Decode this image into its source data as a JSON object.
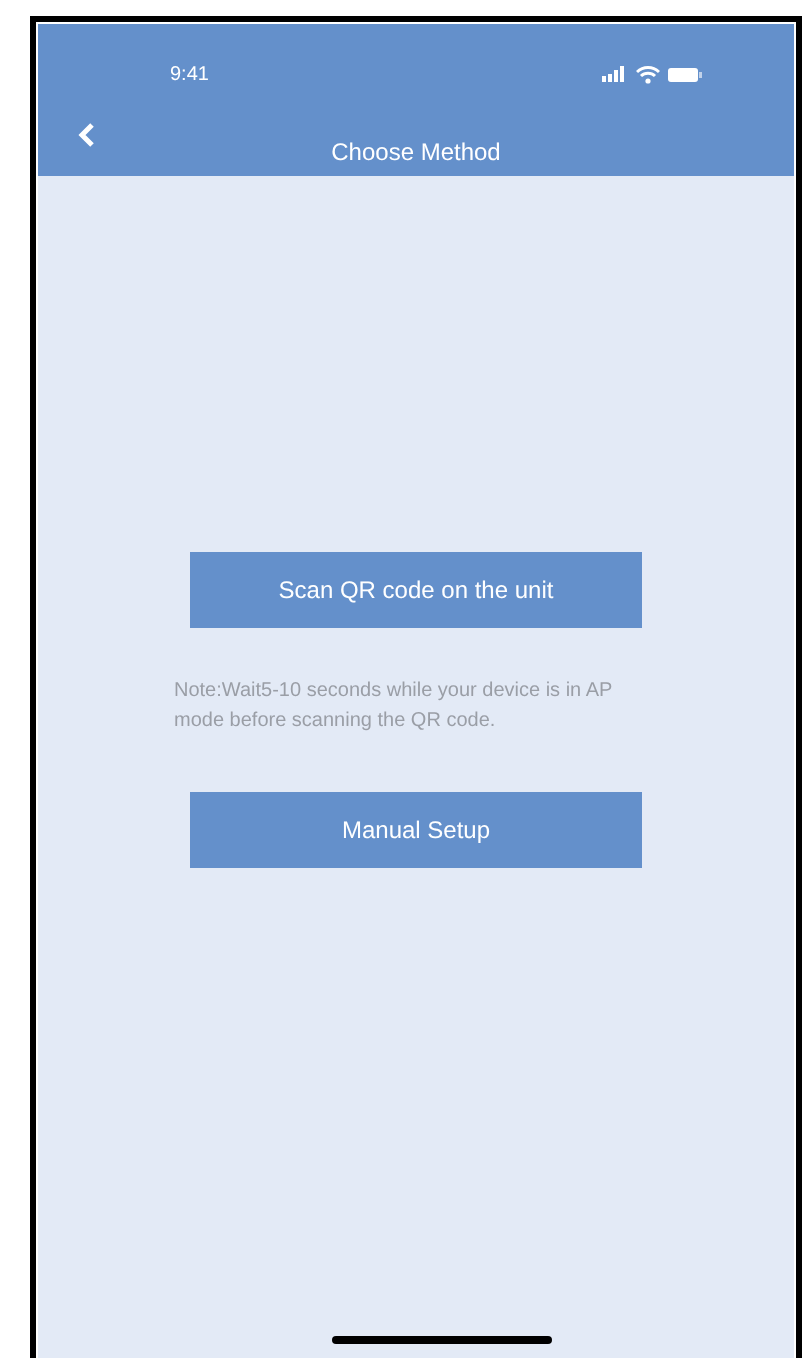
{
  "status_bar": {
    "time": "9:41"
  },
  "header": {
    "title": "Choose Method"
  },
  "buttons": [
    {
      "label": "Scan QR code on the unit"
    },
    {
      "label": "Manual Setup"
    }
  ],
  "note": "Note:Wait5-10 seconds while your device is in AP mode before scanning the QR code."
}
